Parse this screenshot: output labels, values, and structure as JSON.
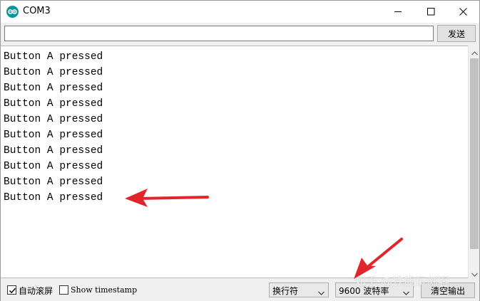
{
  "window": {
    "title": "COM3",
    "icon": "arduino-icon",
    "controls": [
      "minimize-icon",
      "maximize-icon",
      "close-icon"
    ]
  },
  "send": {
    "input_value": "",
    "button_label": "发送"
  },
  "output": {
    "lines": [
      "Button A pressed",
      "Button A pressed",
      "Button A pressed",
      "Button A pressed",
      "Button A pressed",
      "Button A pressed",
      "Button A pressed",
      "Button A pressed",
      "Button A pressed",
      "Button A pressed"
    ]
  },
  "footer": {
    "autoscroll_label": "自动滚屏",
    "autoscroll_checked": true,
    "timestamp_label": "Show timestamp",
    "timestamp_checked": false,
    "line_ending_value": "换行符",
    "baud_value": "9600",
    "baud_unit": "波特率",
    "clear_label": "清空输出"
  },
  "watermark": "知乎 @铁熊玩创客",
  "annotation_color": "#e0262b"
}
